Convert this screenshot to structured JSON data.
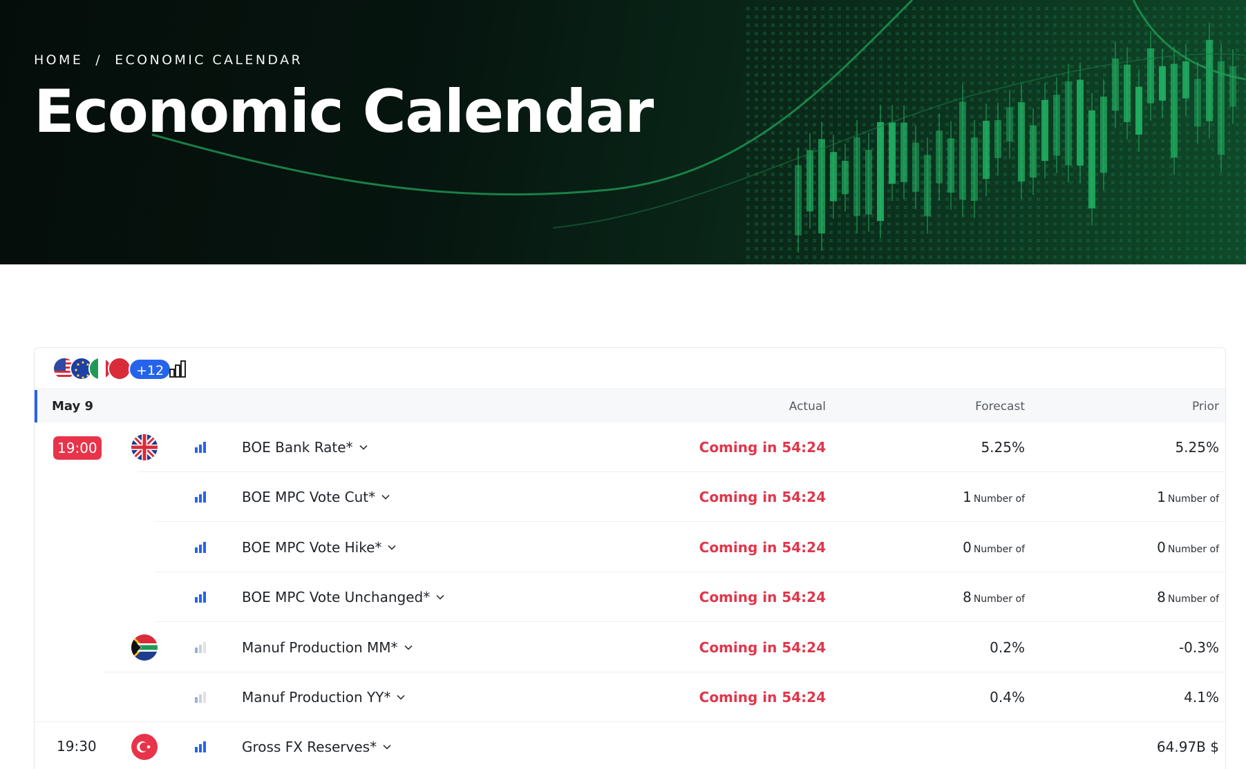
{
  "breadcrumb": {
    "home": "HOME",
    "separator": "/",
    "current": "ECONOMIC CALENDAR"
  },
  "page_title": "Economic Calendar",
  "toolbar": {
    "more_countries_badge": "+12",
    "chart_icon": "bar-chart-icon"
  },
  "table": {
    "date": "May 9",
    "columns": {
      "actual": "Actual",
      "forecast": "Forecast",
      "prior": "Prior"
    },
    "rows": [
      {
        "time": "19:00",
        "time_style": "badge",
        "flag": "gb",
        "impact": "high",
        "event": "BOE Bank Rate*",
        "actual": "Coming in 54:24",
        "forecast": "5.25",
        "forecast_unit": "%",
        "prior": "5.25",
        "prior_unit": "%"
      },
      {
        "time": "",
        "flag": "",
        "impact": "high",
        "event": "BOE MPC Vote Cut*",
        "actual": "Coming in 54:24",
        "forecast": "1",
        "forecast_unit": "Number of",
        "prior": "1",
        "prior_unit": "Number of"
      },
      {
        "time": "",
        "flag": "",
        "impact": "high",
        "event": "BOE MPC Vote Hike*",
        "actual": "Coming in 54:24",
        "forecast": "0",
        "forecast_unit": "Number of",
        "prior": "0",
        "prior_unit": "Number of"
      },
      {
        "time": "",
        "flag": "",
        "impact": "high",
        "event": "BOE MPC Vote Unchanged*",
        "actual": "Coming in 54:24",
        "forecast": "8",
        "forecast_unit": "Number of",
        "prior": "8",
        "prior_unit": "Number of"
      },
      {
        "time": "",
        "flag": "za",
        "impact": "low",
        "event": "Manuf Production MM*",
        "actual": "Coming in 54:24",
        "forecast": "0.2",
        "forecast_unit": "%",
        "prior": "-0.3",
        "prior_unit": "%"
      },
      {
        "time": "",
        "flag": "",
        "impact": "low",
        "event": "Manuf Production YY*",
        "actual": "Coming in 54:24",
        "forecast": "0.4",
        "forecast_unit": "%",
        "prior": "4.1",
        "prior_unit": "%"
      },
      {
        "time": "19:30",
        "time_style": "plain",
        "flag": "tr",
        "impact": "high",
        "event": "Gross FX Reserves*",
        "actual": "",
        "forecast": "",
        "forecast_unit": "",
        "prior": "64.97B",
        "prior_unit": "$"
      }
    ]
  },
  "colors": {
    "accent_blue": "#2563eb",
    "coming_red": "#e0364b",
    "badge_red": "#e8344a"
  }
}
